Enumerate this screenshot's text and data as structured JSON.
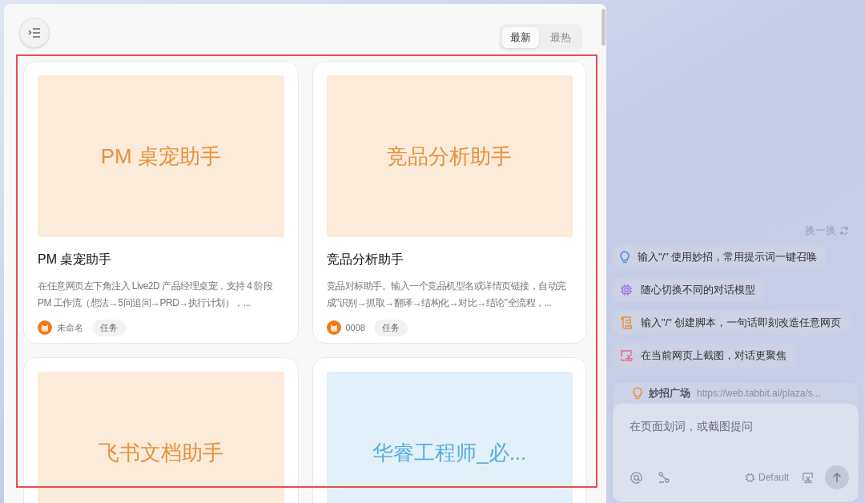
{
  "sort_tabs": [
    {
      "label": "最新",
      "selected": true
    },
    {
      "label": "最热",
      "selected": false
    }
  ],
  "cards": [
    {
      "cover_title": "PM 桌宠助手",
      "color": "#e8913a",
      "name": "PM 桌宠助手",
      "description": "在任意网页左下角注入 Live2D 产品经理桌宠，支持 4 阶段 PM 工作流（想法→5问追问→PRD→执行计划），...",
      "author": "未命名",
      "tag": "任务"
    },
    {
      "cover_title": "竞品分析助手",
      "color": "#e8913a",
      "name": "竞品分析助手",
      "description": "竞品对标助手。输入一个竞品机型名或详情页链接，自动完成\"识别→抓取→翻译→结构化→对比→结论\"全流程，...",
      "author": "0008",
      "tag": "任务"
    },
    {
      "cover_title": "飞书文档助手",
      "color": "#e8913a"
    },
    {
      "cover_title": "华睿工程师_必...",
      "color": "#5aaedc"
    }
  ],
  "shuffle": {
    "label": "换一换"
  },
  "tips": [
    {
      "kind": "bulb",
      "text": "输入\"/\" 使用妙招，常用提示词一键召唤"
    },
    {
      "kind": "chip",
      "text": "随心切换不同的对话模型"
    },
    {
      "kind": "scroll",
      "text": "输入\"/\" 创建脚本，一句话即刻改造任意网页"
    },
    {
      "kind": "screenshot",
      "text": "在当前网页上截图，对话更聚焦"
    }
  ],
  "composer": {
    "plaza_title": "妙招广场",
    "plaza_url": "https://web.tabbit.ai/plaza/s...",
    "placeholder": "在页面划词，或截图提问",
    "model": "Default"
  }
}
